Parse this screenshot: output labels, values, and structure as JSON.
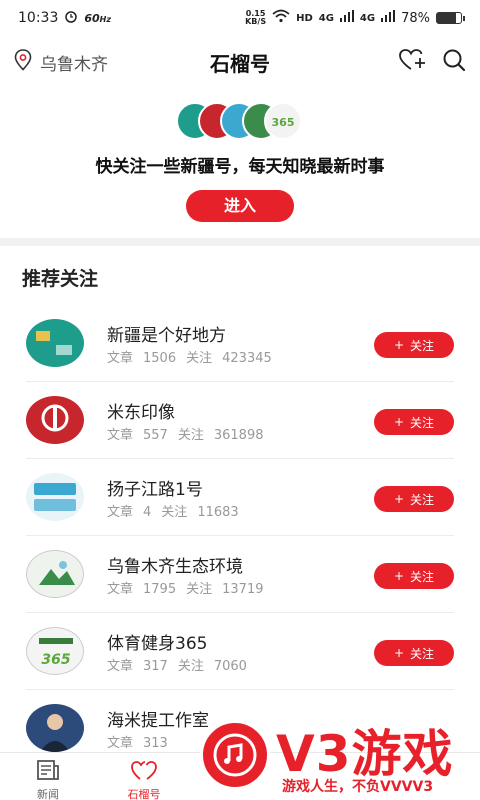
{
  "status_bar": {
    "time": "10:33",
    "refresh_rate": "60",
    "refresh_unit": "Hz",
    "net_speed_value": "0.15",
    "net_speed_unit": "KB/S",
    "hd_label": "HD",
    "network_1": "4G",
    "network_2": "4G",
    "battery_percent": "78%",
    "battery_level": 0.78
  },
  "header": {
    "location": "乌鲁木齐",
    "title": "石榴号"
  },
  "promo": {
    "text": "快关注一些新疆号，每天知晓最新时事",
    "enter_label": "进入"
  },
  "section_title": "推荐关注",
  "stat_labels": {
    "articles": "文章",
    "followers": "关注"
  },
  "follow_button": {
    "plus": "+",
    "label": "关注"
  },
  "accounts": [
    {
      "name": "新疆是个好地方",
      "articles": "1506",
      "followers": "423345",
      "color": "#1e9c8c"
    },
    {
      "name": "米东印像",
      "articles": "557",
      "followers": "361898",
      "color": "#c7262c"
    },
    {
      "name": "扬子江路1号",
      "articles": "4",
      "followers": "11683",
      "color": "#3aa8d0"
    },
    {
      "name": "乌鲁木齐生态环境",
      "articles": "1795",
      "followers": "13719",
      "color": "#3b8c4a"
    },
    {
      "name": "体育健身365",
      "articles": "317",
      "followers": "7060",
      "color": "#5aa83a"
    },
    {
      "name": "海米提工作室",
      "articles": "313",
      "followers": "",
      "color": "#2c4a7a"
    }
  ],
  "bottom_nav": {
    "news": "新闻",
    "shiliu": "石榴号"
  },
  "watermark": {
    "big": "V3游戏",
    "small": "游戏人生，不负VVVV3"
  }
}
